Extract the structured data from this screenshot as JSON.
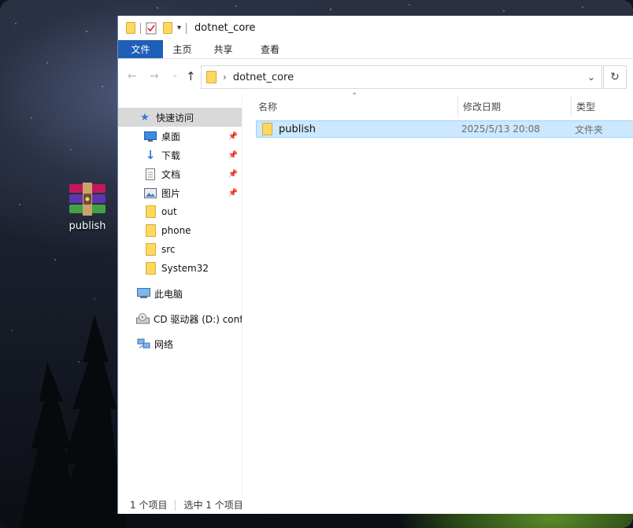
{
  "desktop": {
    "icon_label": "publish"
  },
  "window": {
    "title": "dotnet_core",
    "ribbon_tabs": [
      "文件",
      "主页",
      "共享",
      "查看"
    ],
    "address": {
      "path_segment": "dotnet_core"
    },
    "nav_pane": {
      "quick_access": "快速访问",
      "items": [
        {
          "label": "桌面",
          "pinned": true,
          "icon": "desktop-icon"
        },
        {
          "label": "下载",
          "pinned": true,
          "icon": "download-icon"
        },
        {
          "label": "文档",
          "pinned": true,
          "icon": "document-icon"
        },
        {
          "label": "图片",
          "pinned": true,
          "icon": "pictures-icon"
        },
        {
          "label": "out",
          "pinned": false,
          "icon": "folder-icon"
        },
        {
          "label": "phone",
          "pinned": false,
          "icon": "folder-icon"
        },
        {
          "label": "src",
          "pinned": false,
          "icon": "folder-icon"
        },
        {
          "label": "System32",
          "pinned": false,
          "icon": "folder-icon"
        }
      ],
      "this_pc": "此电脑",
      "cd_drive": "CD 驱动器 (D:) conf",
      "network": "网络"
    },
    "columns": {
      "name": "名称",
      "modified": "修改日期",
      "type": "类型"
    },
    "files": [
      {
        "name": "publish",
        "modified": "2025/5/13 20:08",
        "type": "文件夹",
        "selected": true
      }
    ],
    "status": {
      "count": "1 个项目",
      "selected": "选中 1 个项目"
    }
  },
  "colors": {
    "file_tab_bg": "#1f5fb8",
    "selection_bg": "#cce8ff",
    "selection_border": "#99d1ff",
    "folder_yellow": "#ffd861"
  }
}
